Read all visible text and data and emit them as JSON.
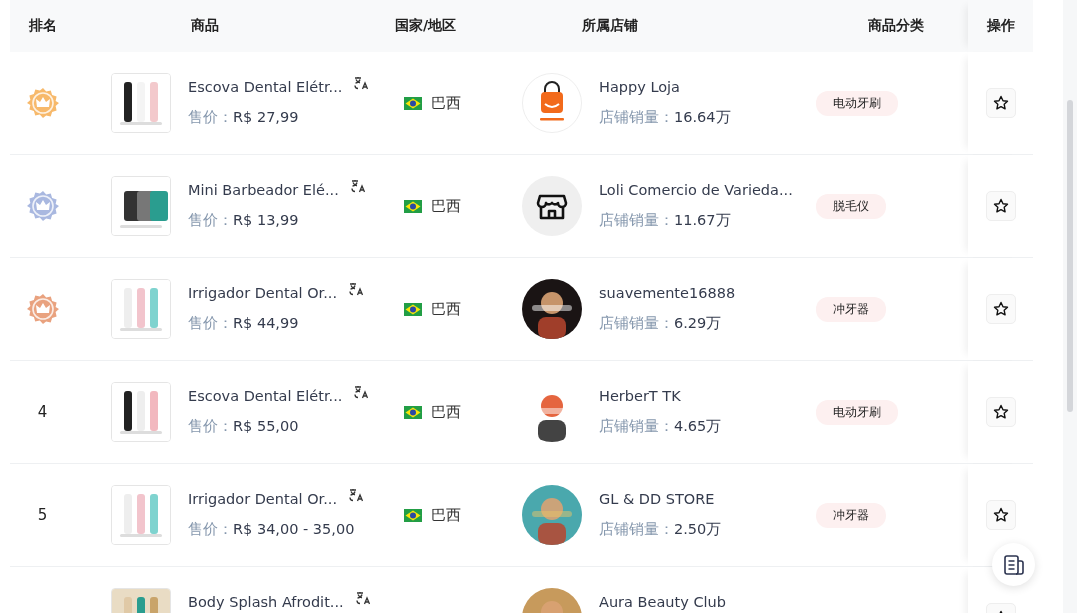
{
  "table": {
    "columns": [
      "排名",
      "商品",
      "国家/地区",
      "所属店铺",
      "商品分类",
      "操作"
    ],
    "rows": [
      {
        "rank": {
          "kind": "medal",
          "color": "#f7b96b"
        },
        "product": {
          "name": "Escova Dental Elétr...",
          "price_label": "售价：",
          "price": "R$ 27,99"
        },
        "country": "巴西",
        "store": {
          "kind": "logo",
          "name": "Happy Loja",
          "sales_label": "店铺销量：",
          "sales": "16.64万"
        },
        "category": "电动牙刷"
      },
      {
        "rank": {
          "kind": "medal",
          "color": "#a9b8e0"
        },
        "product": {
          "name": "Mini Barbeador Elé...",
          "price_label": "售价：",
          "price": "R$ 13,99"
        },
        "country": "巴西",
        "store": {
          "kind": "icon",
          "name": "Loli Comercio de Varieda...",
          "sales_label": "店铺销量：",
          "sales": "11.67万"
        },
        "category": "脱毛仪"
      },
      {
        "rank": {
          "kind": "medal",
          "color": "#e9a27f"
        },
        "product": {
          "name": "Irrigador Dental Or...",
          "price_label": "售价：",
          "price": "R$ 44,99"
        },
        "country": "巴西",
        "store": {
          "kind": "picture",
          "name": "suavemente16888",
          "sales_label": "店铺销量：",
          "sales": "6.29万"
        },
        "category": "冲牙器"
      },
      {
        "rank": {
          "kind": "number",
          "text": "4"
        },
        "product": {
          "name": "Escova Dental Elétr...",
          "price_label": "售价：",
          "price": "R$ 55,00"
        },
        "country": "巴西",
        "store": {
          "kind": "picture",
          "name": "HerberT TK",
          "sales_label": "店铺销量：",
          "sales": "4.65万"
        },
        "category": "电动牙刷"
      },
      {
        "rank": {
          "kind": "number",
          "text": "5"
        },
        "product": {
          "name": "Irrigador Dental Or...",
          "price_label": "售价：",
          "price": "R$ 34,00 - 35,00"
        },
        "country": "巴西",
        "store": {
          "kind": "picture",
          "name": "GL & DD STORE",
          "sales_label": "店铺销量：",
          "sales": "2.50万"
        },
        "category": "冲牙器"
      },
      {
        "rank": {
          "kind": "none"
        },
        "product": {
          "name": "Body Splash Afrodit..."
        },
        "store": {
          "kind": "picture",
          "name": "Aura Beauty Club"
        }
      }
    ]
  }
}
